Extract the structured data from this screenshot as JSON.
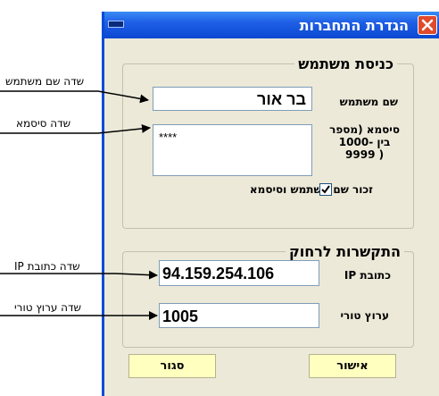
{
  "dialog": {
    "title": "הגדרת התחברות",
    "login_group": {
      "legend": "כניסת משתמש",
      "username_label": "שם משתמש",
      "username_value": "בר אור",
      "password_label": [
        "סיסמא (מספר",
        "בין -1000",
        "( 9999"
      ],
      "password_value": "****",
      "remember_label": "זכור שם משתמש וסיסמא",
      "remember_checked": true
    },
    "remote_group": {
      "legend": "התקשרות לרחוק",
      "ip_label": "כתובת IP",
      "ip_value": "94.159.254.106",
      "port_label": "ערוץ טורי",
      "port_value": "1005"
    },
    "ok_button": "אישור",
    "close_button": "סגור"
  },
  "annotations": {
    "username": "שדה שם משתמש",
    "password": "שדה סיסמא",
    "ip": "שדה כתובת IP",
    "port": "שדה ערוץ טורי"
  }
}
